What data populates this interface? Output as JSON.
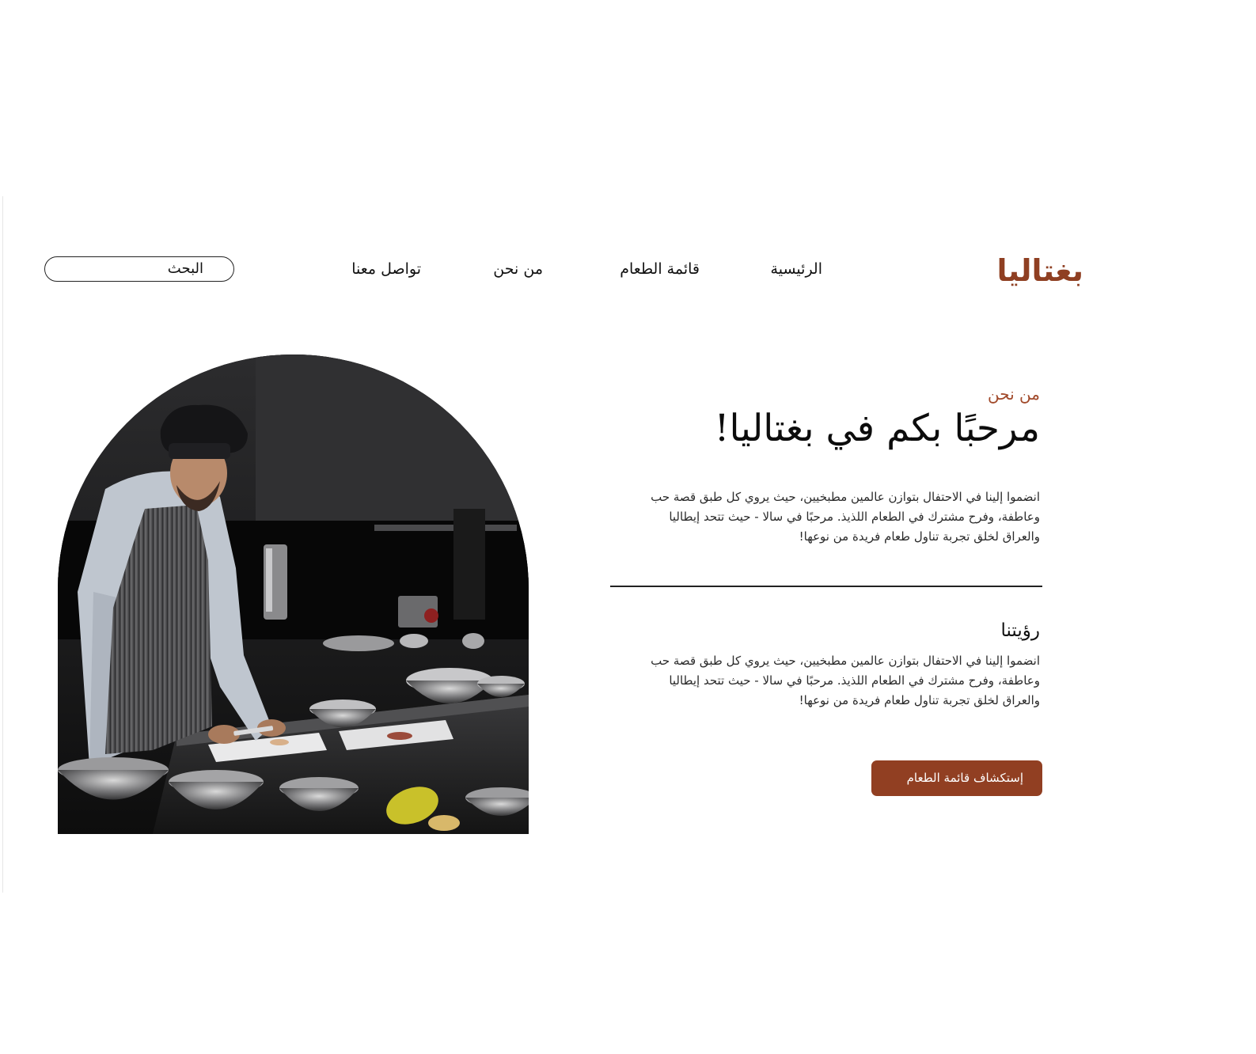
{
  "brand": {
    "logo_text": "بغتاليا",
    "accent_color": "#913f22"
  },
  "nav": {
    "items": [
      {
        "label": "الرئيسية"
      },
      {
        "label": "قائمة الطعام"
      },
      {
        "label": "من نحن"
      },
      {
        "label": "تواصل معنا"
      }
    ]
  },
  "search": {
    "placeholder": "البحث"
  },
  "hero": {
    "image_icon": "chef-in-kitchen-photo",
    "eyebrow": "من نحن",
    "title": "مرحبًا بكم في بغتاليا!",
    "intro": "انضموا إلينا في الاحتفال بتوازن عالمين مطبخيين، حيث يروي كل طبق قصة حب وعاطفة، وفرح مشترك في الطعام اللذيذ. مرحبًا في سالا - حيث تتحد إيطاليا والعراق لخلق تجربة تناول طعام فريدة من نوعها!"
  },
  "vision": {
    "title": "رؤيتنا",
    "text": "انضموا إلينا في الاحتفال بتوازن عالمين مطبخيين، حيث يروي كل طبق قصة حب وعاطفة، وفرح مشترك في الطعام اللذيذ. مرحبًا في سالا - حيث تتحد إيطاليا والعراق لخلق تجربة تناول طعام فريدة من نوعها!"
  },
  "cta": {
    "label": "إستكشاف قائمة الطعام"
  }
}
